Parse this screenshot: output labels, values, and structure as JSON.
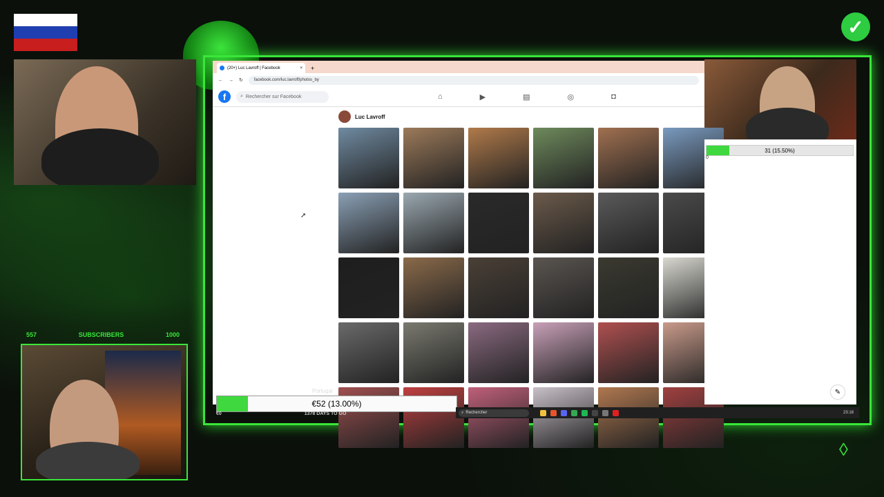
{
  "browser": {
    "tab_title": "(20+) Luc Lavroff | Facebook",
    "new_tab_label": "+",
    "close_tab_label": "×",
    "url": "facebook.com/luc.lavroff/photos_by"
  },
  "facebook": {
    "logo_letter": "f",
    "search_placeholder": "Rechercher sur Facebook",
    "profile_name": "Luc Lavroff"
  },
  "overlay": {
    "subscribers_current": "557",
    "subscribers_label": "SUBSCRIBERS",
    "subscribers_goal": "1000",
    "goal_text": "31 (15.50%)",
    "goal_fraction": 0.155,
    "goal_sub_value": "0",
    "donation_text": "€52 (13.00%)",
    "donation_fraction": 0.13,
    "donation_caption": "1378 DAYS TO GO",
    "donation_left": "€0",
    "portugal_text": "Portugal"
  },
  "taskbar": {
    "search_text": "Rechercher",
    "time": "23:18"
  },
  "colors": {
    "accent_green": "#39e639",
    "facebook_blue": "#1877f2"
  },
  "icons": {
    "home": "home-icon",
    "video": "video-icon",
    "marketplace": "marketplace-icon",
    "groups": "groups-icon",
    "gaming": "gaming-icon"
  },
  "photos": [
    "#6f8aa0",
    "#9c7a5a",
    "#b07a4a",
    "#6e8a5c",
    "#a07050",
    "#7a9abf",
    "#8aa0b5",
    "#9aa8b0",
    "#2a2a2a",
    "#6b5a4a",
    "#5a5a5a",
    "#4a4a4a",
    "#1e1e1e",
    "#8a6a4a",
    "#4a4036",
    "#5a5550",
    "#3a3a30",
    "#d8d8d0",
    "#6a6a6a",
    "#7a7a70",
    "#8a6a80",
    "#c8a0b8",
    "#b05050",
    "#c89a8a",
    "#a05050",
    "#c04040",
    "#c0607a",
    "#c8c0c8",
    "#b07850",
    "#a04040"
  ]
}
